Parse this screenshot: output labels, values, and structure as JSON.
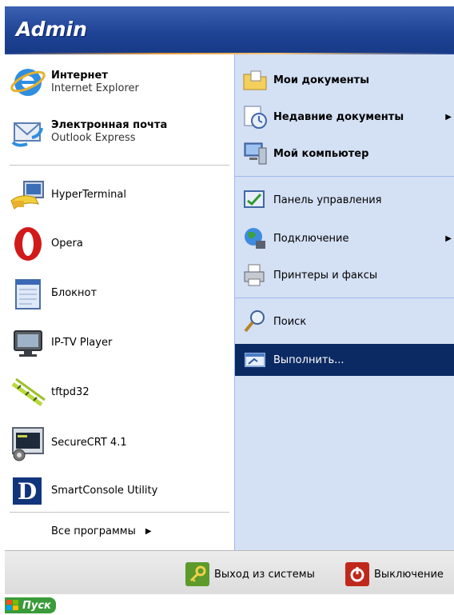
{
  "header": {
    "user": "Admin"
  },
  "pinned": [
    {
      "title": "Интернет",
      "subtitle": "Internet Explorer"
    },
    {
      "title": "Электронная почта",
      "subtitle": "Outlook Express"
    }
  ],
  "programs": [
    {
      "label": "HyperTerminal"
    },
    {
      "label": "Opera"
    },
    {
      "label": "Блокнот"
    },
    {
      "label": "IP-TV Player"
    },
    {
      "label": "tftpd32"
    },
    {
      "label": "SecureCRT 4.1"
    },
    {
      "label": "SmartConsole Utility"
    }
  ],
  "all_programs": {
    "label": "Все программы",
    "arrow": "▶"
  },
  "right": [
    {
      "label": "Мои документы"
    },
    {
      "label": "Недавние документы",
      "arrow": "▶"
    },
    {
      "label": "Мой компьютер"
    },
    {
      "label": "Панель управления"
    },
    {
      "label": "Подключение",
      "arrow": "▶"
    },
    {
      "label": "Принтеры и факсы"
    },
    {
      "label": "Поиск"
    },
    {
      "label": "Выполнить..."
    }
  ],
  "bottom": {
    "logoff": "Выход из системы",
    "shutdown": "Выключение"
  },
  "taskbar": {
    "start": "Пуск"
  }
}
